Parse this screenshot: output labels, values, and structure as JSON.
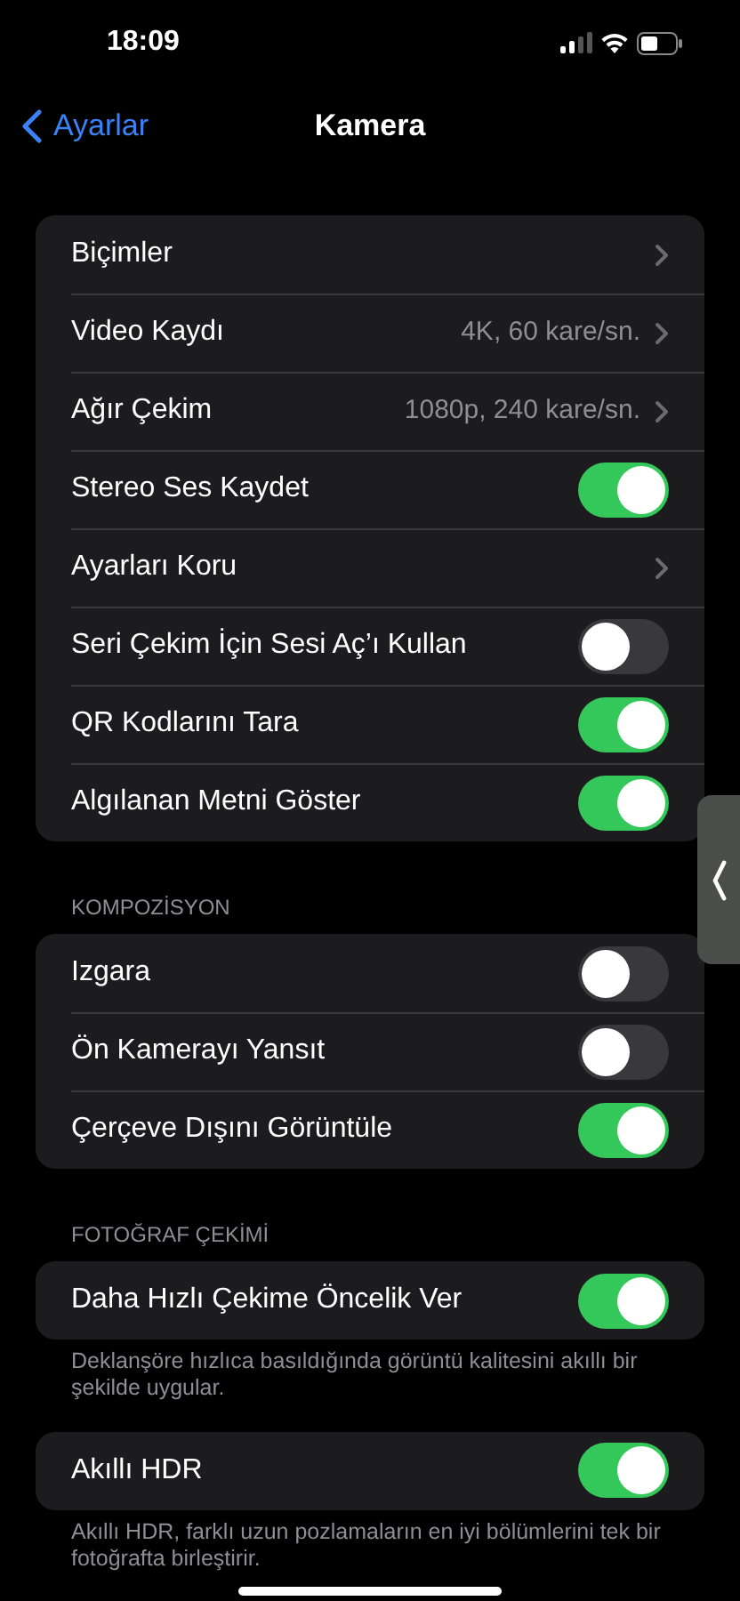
{
  "status_bar": {
    "time": "18:09"
  },
  "nav": {
    "back": "Ayarlar",
    "title": "Kamera"
  },
  "sections": [
    {
      "rows": [
        {
          "kind": "link",
          "label": "Biçimler"
        },
        {
          "kind": "link",
          "label": "Video Kaydı",
          "value": "4K, 60 kare/sn."
        },
        {
          "kind": "link",
          "label": "Ağır Çekim",
          "value": "1080p, 240 kare/sn."
        },
        {
          "kind": "toggle",
          "label": "Stereo Ses Kaydet",
          "on": true
        },
        {
          "kind": "link",
          "label": "Ayarları Koru"
        },
        {
          "kind": "toggle",
          "label": "Seri Çekim İçin Sesi Aç’ı Kullan",
          "on": false
        },
        {
          "kind": "toggle",
          "label": "QR Kodlarını Tara",
          "on": true
        },
        {
          "kind": "toggle",
          "label": "Algılanan Metni Göster",
          "on": true
        }
      ]
    },
    {
      "header": "KOMPOZİSYON",
      "rows": [
        {
          "kind": "toggle",
          "label": "Izgara",
          "on": false
        },
        {
          "kind": "toggle",
          "label": "Ön Kamerayı Yansıt",
          "on": false
        },
        {
          "kind": "toggle",
          "label": "Çerçeve Dışını Görüntüle",
          "on": true
        }
      ]
    },
    {
      "header": "FOTOĞRAF ÇEKİMİ",
      "rows": [
        {
          "kind": "toggle",
          "label": "Daha Hızlı Çekime Öncelik Ver",
          "on": true
        }
      ],
      "footer": "Deklanşöre hızlıca basıldığında görüntü kalitesini akıllı bir şekilde uygular."
    },
    {
      "rows": [
        {
          "kind": "toggle",
          "label": "Akıllı HDR",
          "on": true
        }
      ],
      "footer": "Akıllı HDR, farklı uzun pozlamaların en iyi bölümlerini tek bir fotoğrafta birleştirir."
    }
  ]
}
